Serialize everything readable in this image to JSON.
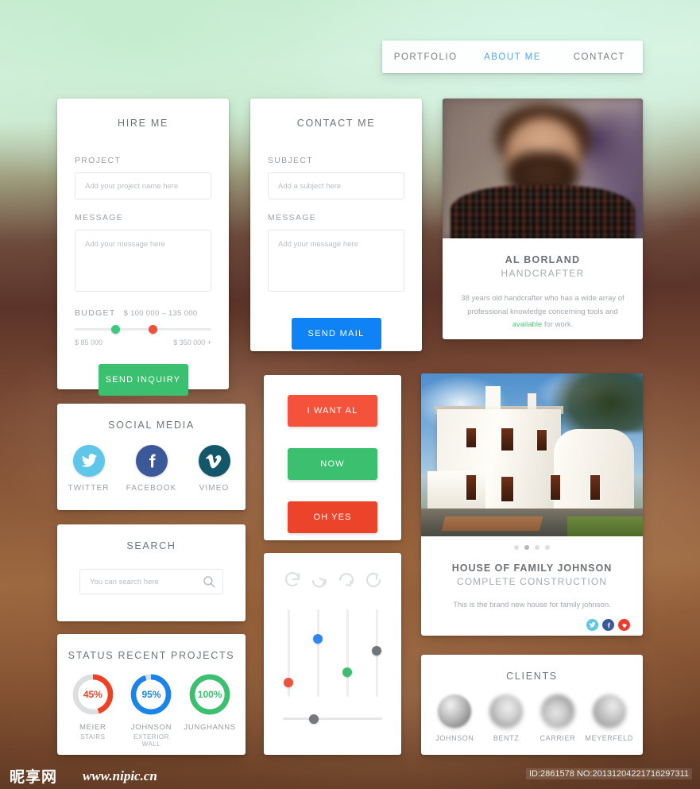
{
  "nav": {
    "items": [
      {
        "label": "PORTFOLIO",
        "active": false
      },
      {
        "label": "ABOUT ME",
        "active": true
      },
      {
        "label": "CONTACT",
        "active": false
      }
    ],
    "active_color": "#4ea7f0"
  },
  "hire": {
    "title": "HIRE ME",
    "project_label": "PROJECT",
    "project_placeholder": "Add your project name here",
    "project_value": "",
    "message_label": "MESSAGE",
    "message_placeholder": "Add your message here",
    "message_value": "",
    "budget_label": "BUDGET",
    "budget_value": "$ 100 000 – 135 000",
    "range_min_label": "$ 85 000",
    "range_max_label": "$ 350 000 +",
    "knob_low_color": "#3ec97a",
    "knob_high_color": "#f0513c",
    "knob_low_pct": 27,
    "knob_high_pct": 54,
    "submit_label": "SEND INQUIRY",
    "submit_color": "#3ac06f"
  },
  "contact": {
    "title": "CONTACT ME",
    "subject_label": "SUBJECT",
    "subject_placeholder": "Add a subject here",
    "subject_value": "",
    "message_label": "MESSAGE",
    "message_placeholder": "Add your message here",
    "message_value": "",
    "submit_label": "SEND MAIL",
    "submit_color": "#0f82f5"
  },
  "about": {
    "name": "AL BORLAND",
    "role": "HANDCRAFTER",
    "desc_part1": "38 years old handcrafter who has a wide array of professional knowledge concerning tools and ",
    "desc_highlight": "available",
    "desc_part2": " for work.",
    "highlight_color": "#4fc57f"
  },
  "social": {
    "title": "SOCIAL MEDIA",
    "items": [
      {
        "name": "TWITTER",
        "icon": "twitter-bird-icon",
        "color": "#5ec6e8"
      },
      {
        "name": "FACEBOOK",
        "icon": "facebook-f-icon",
        "color": "#3b5998"
      },
      {
        "name": "VIMEO",
        "icon": "vimeo-v-icon",
        "color": "#14576b"
      }
    ]
  },
  "search": {
    "title": "SEARCH",
    "placeholder": "You can search here",
    "value": "",
    "icon": "magnifier-icon"
  },
  "status": {
    "title": "STATUS RECENT PROJECTS",
    "projects": [
      {
        "name": "MEIER",
        "sub": "STAIRS",
        "percent": 45,
        "label": "45%",
        "color": "#f04124",
        "track": "#dcdedf"
      },
      {
        "name": "JOHNSON",
        "sub": "EXTERIOR WALL",
        "percent": 95,
        "label": "95%",
        "color": "#1a84e8",
        "track": "#dcdedf"
      },
      {
        "name": "JUNGHANNS",
        "sub": "",
        "percent": 100,
        "label": "100%",
        "color": "#3ac06f",
        "track": "#dcdedf"
      }
    ]
  },
  "buttons": {
    "items": [
      {
        "label": "I WANT AL",
        "color": "#f4523a"
      },
      {
        "label": "NOW",
        "color": "#3ac06f"
      },
      {
        "label": "OH YES",
        "color": "#ec442b"
      }
    ]
  },
  "controls": {
    "refresh_icons": [
      "refresh-cw-icon",
      "refresh-cw-icon",
      "refresh-ccw-icon",
      "refresh-ccw-icon"
    ],
    "vertical_sliders": [
      {
        "value_pct": 22,
        "color": "#f0513c"
      },
      {
        "value_pct": 72,
        "color": "#2f86f2"
      },
      {
        "value_pct": 34,
        "color": "#3ac06f"
      },
      {
        "value_pct": 58,
        "color": "#6e7478"
      }
    ],
    "horizontal_slider": {
      "value_pct": 26,
      "color": "#74797d"
    }
  },
  "project": {
    "title": "HOUSE OF FAMILY JOHNSON",
    "subtitle": "COMPLETE CONSTRUCTION",
    "description": "This is the brand new house for family johnson.",
    "dots_total": 4,
    "dots_active_index": 1,
    "share": [
      {
        "icon": "twitter-bird-icon",
        "color": "#5ec6e8"
      },
      {
        "icon": "facebook-f-icon",
        "color": "#3b5998"
      },
      {
        "icon": "heart-icon",
        "color": "#ee3b2f"
      }
    ]
  },
  "clients": {
    "title": "CLIENTS",
    "items": [
      {
        "name": "JOHNSON"
      },
      {
        "name": "BENTZ"
      },
      {
        "name": "CARRIER"
      },
      {
        "name": "MEYERFELD"
      }
    ]
  },
  "watermark": {
    "logo": "昵享网",
    "url": "www.nipic.cn",
    "id_text": "ID:2861578 NO:20131204221716297311"
  }
}
